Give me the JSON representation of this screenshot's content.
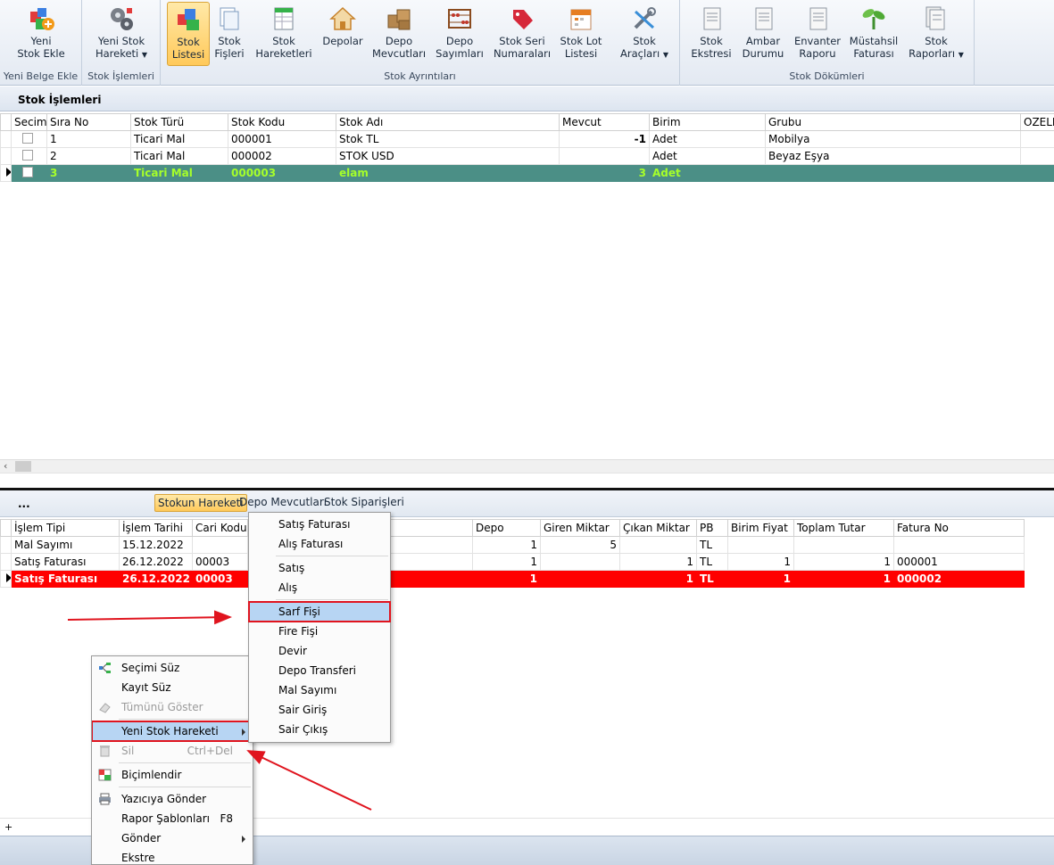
{
  "ribbon": {
    "groups": [
      {
        "label": "Yeni Belge Ekle",
        "buttons": [
          {
            "label1": "Yeni",
            "label2": "Stok Ekle",
            "icon": "add-stock-icon"
          }
        ]
      },
      {
        "label": "Stok İşlemleri",
        "buttons": [
          {
            "label1": "Yeni Stok",
            "label2": "Hareketi",
            "icon": "gears-icon"
          }
        ]
      },
      {
        "label": "Stok Ayrıntıları",
        "buttons": [
          {
            "label1": "Stok",
            "label2": "Listesi",
            "icon": "boxes-icon"
          },
          {
            "label1": "Stok",
            "label2": "Fişleri",
            "icon": "documents-icon"
          },
          {
            "label1": "Stok",
            "label2": "Hareketleri",
            "icon": "sheet-icon"
          },
          {
            "label1": "Depolar",
            "label2": "",
            "icon": "house-icon"
          },
          {
            "label1": "Depo",
            "label2": "Mevcutları",
            "icon": "crates-icon"
          },
          {
            "label1": "Depo",
            "label2": "Sayımları",
            "icon": "abacus-icon"
          },
          {
            "label1": "Stok Seri",
            "label2": "Numaraları",
            "icon": "tag-icon"
          },
          {
            "label1": "Stok Lot",
            "label2": "Listesi",
            "icon": "calendar-icon"
          },
          {
            "label1": "Stok",
            "label2": "Araçları",
            "icon": "tools-icon"
          }
        ]
      },
      {
        "label": "Stok Dökümleri",
        "buttons": [
          {
            "label1": "Stok",
            "label2": "Ekstresi",
            "icon": "report-icon"
          },
          {
            "label1": "Ambar",
            "label2": "Durumu",
            "icon": "report-icon"
          },
          {
            "label1": "Envanter",
            "label2": "Raporu",
            "icon": "report-icon"
          },
          {
            "label1": "Müstahsil",
            "label2": "Faturası",
            "icon": "plant-icon"
          },
          {
            "label1": "Stok",
            "label2": "Raporları",
            "icon": "reports-icon"
          }
        ]
      }
    ]
  },
  "section_title": "Stok İşlemleri",
  "stock_grid": {
    "columns": [
      "Secim",
      "Sıra No",
      "Stok Türü",
      "Stok Kodu",
      "Stok Adı",
      "Mevcut",
      "Birim",
      "Grubu",
      "OZELKOD"
    ],
    "rows": [
      {
        "sira": "1",
        "tur": "Ticari Mal",
        "kod": "000001",
        "ad": "Stok TL",
        "mevcut": "-1",
        "birim": "Adet",
        "grubu": "Mobilya"
      },
      {
        "sira": "2",
        "tur": "Ticari Mal",
        "kod": "000002",
        "ad": "STOK USD",
        "mevcut": "",
        "birim": "Adet",
        "grubu": "Beyaz Eşya"
      },
      {
        "sira": "3",
        "tur": "Ticari Mal",
        "kod": "000003",
        "ad": "elam",
        "mevcut": "3",
        "birim": "Adet",
        "grubu": ""
      }
    ]
  },
  "lower_tabs": {
    "dots": "...",
    "items": [
      "Stokun Hareketi",
      "Depo Mevcutları",
      "Stok Siparişleri"
    ]
  },
  "movement_grid": {
    "columns": [
      "İşlem Tipi",
      "İşlem Tarihi",
      "Cari Kodu",
      "",
      "Depo",
      "Giren Miktar",
      "Çıkan Miktar",
      "PB",
      "Birim Fiyat",
      "Toplam Tutar",
      "Fatura No"
    ],
    "rows": [
      {
        "tip": "Mal Sayımı",
        "tarih": "15.12.2022",
        "cari": "",
        "depo": "1",
        "giren": "5",
        "cikan": "",
        "pb": "TL",
        "fiyat": "",
        "tutar": "",
        "fatura": ""
      },
      {
        "tip": "Satış Faturası",
        "tarih": "26.12.2022",
        "cari": "00003",
        "depo": "1",
        "giren": "",
        "cikan": "1",
        "pb": "TL",
        "fiyat": "1",
        "tutar": "1",
        "fatura": "000001"
      },
      {
        "tip": "Satış Faturası",
        "tarih": "26.12.2022",
        "cari": "00003",
        "depo": "1",
        "giren": "",
        "cikan": "1",
        "pb": "TL",
        "fiyat": "1",
        "tutar": "1",
        "fatura": "000002"
      }
    ]
  },
  "context_menu": {
    "items": [
      {
        "label": "Seçimi Süz"
      },
      {
        "label": "Kayıt Süz"
      },
      {
        "label": "Tümünü Göster"
      },
      {
        "label": "Yeni Stok Hareketi"
      },
      {
        "label": "Sil",
        "shortcut": "Ctrl+Del"
      },
      {
        "label": "Biçimlendir"
      },
      {
        "label": "Yazıcıya Gönder"
      },
      {
        "label": "Rapor Şablonları",
        "shortcut": "F8"
      },
      {
        "label": "Gönder"
      },
      {
        "label": "Ekstre"
      }
    ]
  },
  "sub_menu": {
    "items": [
      "Satış Faturası",
      "Alış Faturası",
      "Satış",
      "Alış",
      "Sarf Fişi",
      "Fire Fişi",
      "Devir",
      "Depo Transferi",
      "Mal Sayımı",
      "Sair Giriş",
      "Sair Çıkış"
    ]
  },
  "colors": {
    "selected_row_green": "#4b8f86",
    "selected_row_red": "#ff0000",
    "highlight_box": "#e0141e",
    "active_tab": "#ffc95a"
  }
}
